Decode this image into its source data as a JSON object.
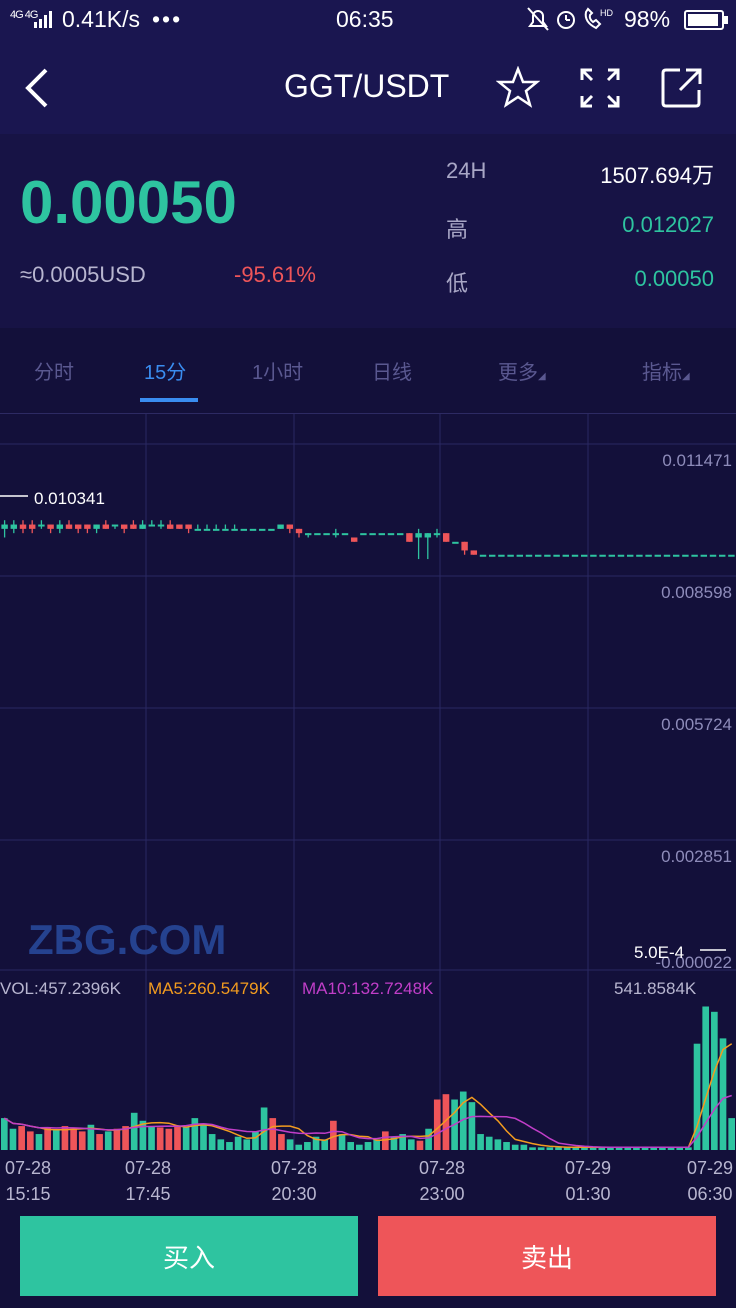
{
  "status_bar": {
    "network": "4G 4G",
    "speed": "0.41K/s",
    "more": "•••",
    "time": "06:35",
    "battery_pct": "98%",
    "battery_level": 0.98
  },
  "header": {
    "pair": "GGT/USDT",
    "icons": [
      "back-icon",
      "star-icon",
      "fullscreen-icon",
      "share-icon"
    ]
  },
  "ticker": {
    "price": "0.00050",
    "usd": "≈0.0005USD",
    "change": "-95.61%",
    "stats": [
      {
        "label": "24H",
        "value": "1507.694万",
        "color": "#ffffff"
      },
      {
        "label": "高",
        "value": "0.012027",
        "color": "#2ec4a0"
      },
      {
        "label": "低",
        "value": "0.00050",
        "color": "#2ec4a0"
      }
    ]
  },
  "tabs": [
    "分时",
    "15分",
    "1小时",
    "日线",
    "更多",
    "指标"
  ],
  "active_tab": "15分",
  "colors": {
    "up": "#2ec4a0",
    "down": "#ee5559",
    "accent": "#3a8df0",
    "ma5": "#f39c1f",
    "ma10": "#c03ec8",
    "bg": "#13103a"
  },
  "chart": {
    "watermark": "ZBG.COM",
    "price_ticks": [
      "0.011471",
      "0.008598",
      "0.005724",
      "0.002851",
      "-0.000022"
    ],
    "max_label": "0.010341",
    "last_label": "5.0E-4",
    "vol_info": {
      "vol": "VOL:457.2396K",
      "ma5": "MA5:260.5479K",
      "ma10": "MA10:132.7248K",
      "vol_max": "541.8584K"
    },
    "time_labels": [
      [
        "07-28",
        "15:15"
      ],
      [
        "07-28",
        "17:45"
      ],
      [
        "07-28",
        "20:30"
      ],
      [
        "07-28",
        "23:00"
      ],
      [
        "07-29",
        "01:30"
      ],
      [
        "07-29",
        "06:30"
      ]
    ]
  },
  "chart_data": {
    "type": "candlestick",
    "interval": "15分",
    "y_range": [
      -2.2e-05,
      0.011471
    ],
    "candles": [
      {
        "o": 0.0102,
        "c": 0.0103,
        "h": 0.0104,
        "l": 0.01
      },
      {
        "o": 0.0102,
        "c": 0.0103,
        "h": 0.0104,
        "l": 0.0101
      },
      {
        "o": 0.0103,
        "c": 0.0102,
        "h": 0.0104,
        "l": 0.0101
      },
      {
        "o": 0.0103,
        "c": 0.0102,
        "h": 0.0104,
        "l": 0.0101
      },
      {
        "o": 0.0103,
        "c": 0.0103,
        "h": 0.0104,
        "l": 0.0102
      },
      {
        "o": 0.0103,
        "c": 0.0102,
        "h": 0.0103,
        "l": 0.0101
      },
      {
        "o": 0.0102,
        "c": 0.0103,
        "h": 0.0104,
        "l": 0.0101
      },
      {
        "o": 0.0103,
        "c": 0.0102,
        "h": 0.0104,
        "l": 0.0102
      },
      {
        "o": 0.0103,
        "c": 0.0102,
        "h": 0.0103,
        "l": 0.0101
      },
      {
        "o": 0.0103,
        "c": 0.0102,
        "h": 0.0103,
        "l": 0.0101
      },
      {
        "o": 0.0102,
        "c": 0.0103,
        "h": 0.0103,
        "l": 0.0101
      },
      {
        "o": 0.0103,
        "c": 0.0102,
        "h": 0.0104,
        "l": 0.0102
      },
      {
        "o": 0.0103,
        "c": 0.0103,
        "h": 0.0103,
        "l": 0.0102
      },
      {
        "o": 0.0103,
        "c": 0.0102,
        "h": 0.0103,
        "l": 0.0101
      },
      {
        "o": 0.0103,
        "c": 0.0102,
        "h": 0.0104,
        "l": 0.0102
      },
      {
        "o": 0.0102,
        "c": 0.0103,
        "h": 0.0104,
        "l": 0.0102
      },
      {
        "o": 0.0103,
        "c": 0.0103,
        "h": 0.0104,
        "l": 0.0103
      },
      {
        "o": 0.0103,
        "c": 0.0103,
        "h": 0.0104,
        "l": 0.0102
      },
      {
        "o": 0.0103,
        "c": 0.0102,
        "h": 0.0104,
        "l": 0.0102
      },
      {
        "o": 0.0103,
        "c": 0.0102,
        "h": 0.0103,
        "l": 0.0102
      },
      {
        "o": 0.0103,
        "c": 0.0102,
        "h": 0.0103,
        "l": 0.0101
      },
      {
        "o": 0.0102,
        "c": 0.0102,
        "h": 0.0103,
        "l": 0.0102
      },
      {
        "o": 0.0102,
        "c": 0.0102,
        "h": 0.0103,
        "l": 0.0102
      },
      {
        "o": 0.0102,
        "c": 0.0102,
        "h": 0.0103,
        "l": 0.0102
      },
      {
        "o": 0.0102,
        "c": 0.0102,
        "h": 0.0103,
        "l": 0.0102
      },
      {
        "o": 0.0102,
        "c": 0.0102,
        "h": 0.0103,
        "l": 0.0102
      },
      {
        "o": 0.0102,
        "c": 0.0102,
        "h": 0.0102,
        "l": 0.0102
      },
      {
        "o": 0.0102,
        "c": 0.0102,
        "h": 0.0102,
        "l": 0.0102
      },
      {
        "o": 0.0102,
        "c": 0.0102,
        "h": 0.0102,
        "l": 0.0102
      },
      {
        "o": 0.0102,
        "c": 0.0102,
        "h": 0.0102,
        "l": 0.0102
      },
      {
        "o": 0.0102,
        "c": 0.0103,
        "h": 0.0103,
        "l": 0.0102
      },
      {
        "o": 0.0103,
        "c": 0.0102,
        "h": 0.0103,
        "l": 0.0101
      },
      {
        "o": 0.0102,
        "c": 0.0101,
        "h": 0.0102,
        "l": 0.01
      },
      {
        "o": 0.0101,
        "c": 0.0101,
        "h": 0.0101,
        "l": 0.01
      },
      {
        "o": 0.0101,
        "c": 0.0101,
        "h": 0.0101,
        "l": 0.0101
      },
      {
        "o": 0.0101,
        "c": 0.0101,
        "h": 0.0101,
        "l": 0.0101
      },
      {
        "o": 0.0101,
        "c": 0.0101,
        "h": 0.0102,
        "l": 0.01
      },
      {
        "o": 0.0101,
        "c": 0.0101,
        "h": 0.0101,
        "l": 0.0101
      },
      {
        "o": 0.01,
        "c": 0.0099,
        "h": 0.01,
        "l": 0.0099
      },
      {
        "o": 0.0101,
        "c": 0.0101,
        "h": 0.0101,
        "l": 0.0101
      },
      {
        "o": 0.0101,
        "c": 0.0101,
        "h": 0.0101,
        "l": 0.0101
      },
      {
        "o": 0.0101,
        "c": 0.0101,
        "h": 0.0101,
        "l": 0.0101
      },
      {
        "o": 0.0101,
        "c": 0.0101,
        "h": 0.0101,
        "l": 0.0101
      },
      {
        "o": 0.0101,
        "c": 0.0101,
        "h": 0.0101,
        "l": 0.0101
      },
      {
        "o": 0.0101,
        "c": 0.0099,
        "h": 0.0101,
        "l": 0.0099
      },
      {
        "o": 0.01,
        "c": 0.0101,
        "h": 0.0102,
        "l": 0.0095
      },
      {
        "o": 0.01,
        "c": 0.0101,
        "h": 0.0101,
        "l": 0.0095
      },
      {
        "o": 0.0101,
        "c": 0.0101,
        "h": 0.0102,
        "l": 0.01
      },
      {
        "o": 0.0101,
        "c": 0.0099,
        "h": 0.0101,
        "l": 0.0099
      },
      {
        "o": 0.0099,
        "c": 0.0099,
        "h": 0.0099,
        "l": 0.0099
      },
      {
        "o": 0.0099,
        "c": 0.0097,
        "h": 0.0099,
        "l": 0.0096
      },
      {
        "o": 0.0097,
        "c": 0.0096,
        "h": 0.0097,
        "l": 0.0096
      },
      {
        "o": 0.0096,
        "c": 0.0096,
        "h": 0.0096,
        "l": 0.0096
      },
      {
        "o": 0.0096,
        "c": 0.0096,
        "h": 0.0096,
        "l": 0.0096
      },
      {
        "o": 0.0096,
        "c": 0.0096,
        "h": 0.0096,
        "l": 0.0096
      },
      {
        "o": 0.0096,
        "c": 0.0096,
        "h": 0.0096,
        "l": 0.0096
      },
      {
        "o": 0.0096,
        "c": 0.0096,
        "h": 0.0096,
        "l": 0.0096
      },
      {
        "o": 0.0096,
        "c": 0.0096,
        "h": 0.0096,
        "l": 0.0096
      },
      {
        "o": 0.0096,
        "c": 0.0096,
        "h": 0.0096,
        "l": 0.0096
      },
      {
        "o": 0.0096,
        "c": 0.0096,
        "h": 0.0096,
        "l": 0.0096
      },
      {
        "o": 0.0096,
        "c": 0.0096,
        "h": 0.0096,
        "l": 0.0096
      },
      {
        "o": 0.0096,
        "c": 0.0096,
        "h": 0.0096,
        "l": 0.0096
      },
      {
        "o": 0.0096,
        "c": 0.0096,
        "h": 0.0096,
        "l": 0.0096
      },
      {
        "o": 0.0096,
        "c": 0.0096,
        "h": 0.0096,
        "l": 0.0096
      },
      {
        "o": 0.0096,
        "c": 0.0096,
        "h": 0.0096,
        "l": 0.0096
      },
      {
        "o": 0.0096,
        "c": 0.0096,
        "h": 0.0096,
        "l": 0.0096
      },
      {
        "o": 0.0096,
        "c": 0.0096,
        "h": 0.0096,
        "l": 0.0096
      },
      {
        "o": 0.0096,
        "c": 0.0096,
        "h": 0.0096,
        "l": 0.0096
      },
      {
        "o": 0.0096,
        "c": 0.0096,
        "h": 0.0096,
        "l": 0.0096
      },
      {
        "o": 0.0096,
        "c": 0.0096,
        "h": 0.0096,
        "l": 0.0096
      },
      {
        "o": 0.0096,
        "c": 0.0096,
        "h": 0.0096,
        "l": 0.0096
      },
      {
        "o": 0.0096,
        "c": 0.0096,
        "h": 0.0096,
        "l": 0.0096
      },
      {
        "o": 0.0096,
        "c": 0.0096,
        "h": 0.0096,
        "l": 0.0096
      },
      {
        "o": 0.0096,
        "c": 0.0096,
        "h": 0.0096,
        "l": 0.0096
      },
      {
        "o": 0.0096,
        "c": 0.0096,
        "h": 0.0096,
        "l": 0.0096
      },
      {
        "o": 0.0096,
        "c": 0.0096,
        "h": 0.0096,
        "l": 0.0096
      },
      {
        "o": 0.0096,
        "c": 0.0096,
        "h": 0.0096,
        "l": 0.0096
      },
      {
        "o": 0.0096,
        "c": 0.0096,
        "h": 0.0096,
        "l": 0.0096
      },
      {
        "o": 0.0096,
        "c": 0.0096,
        "h": 0.0096,
        "l": 0.0096
      },
      {
        "o": 0.0096,
        "c": 0.0096,
        "h": 0.0096,
        "l": 0.0096
      }
    ],
    "volumes": [
      120,
      80,
      90,
      70,
      60,
      85,
      75,
      90,
      80,
      70,
      95,
      60,
      70,
      80,
      90,
      140,
      110,
      90,
      85,
      80,
      90,
      85,
      120,
      100,
      60,
      40,
      30,
      50,
      40,
      70,
      160,
      120,
      60,
      40,
      20,
      30,
      50,
      40,
      110,
      60,
      30,
      20,
      30,
      40,
      70,
      50,
      60,
      40,
      35,
      80,
      190,
      210,
      190,
      220,
      180,
      60,
      50,
      40,
      30,
      20,
      20,
      10,
      10,
      10,
      10,
      10,
      10,
      10,
      10,
      10,
      10,
      10,
      10,
      10,
      10,
      10,
      10,
      10,
      10,
      10,
      400,
      540,
      520,
      420,
      120
    ]
  }
}
